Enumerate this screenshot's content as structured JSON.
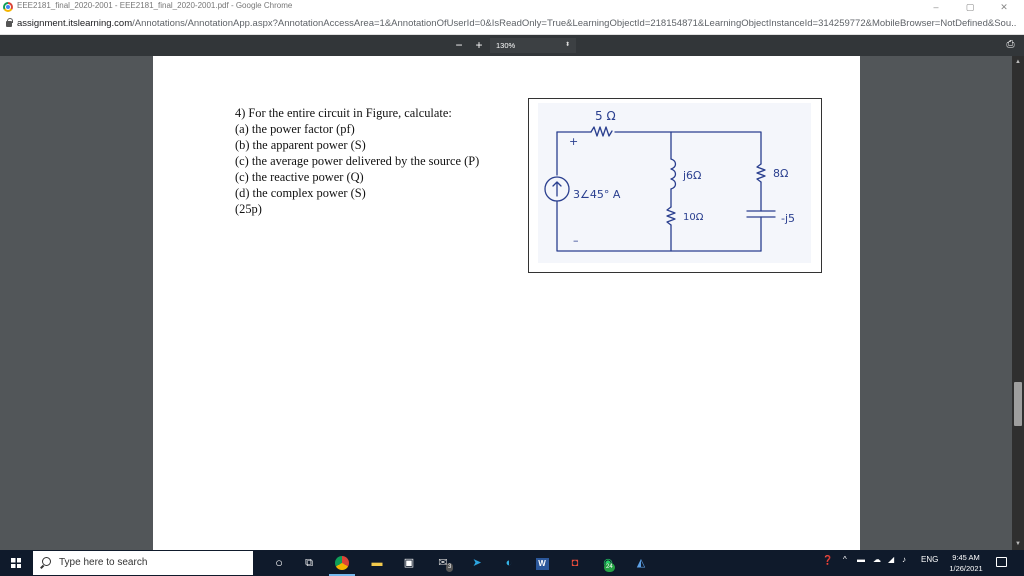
{
  "window": {
    "title": "EEE2181_final_2020-2001 - EEE2181_final_2020-2001.pdf - Google Chrome",
    "controls": {
      "minimize": "–",
      "restore": "▢",
      "close": "✕"
    }
  },
  "address": {
    "host": "assignment.itslearning.com",
    "path": "/Annotations/AnnotationApp.aspx?AnnotationAccessArea=1&AnnotationOfUserId=0&IsReadOnly=True&LearningObjectId=218154871&LearningObjectInstanceId=314259772&MobileBrowser=NotDefined&Sou..."
  },
  "pdf_toolbar": {
    "zoom_out": "−",
    "zoom_in": "+",
    "zoom_value": "130%",
    "zoom_caret": "⬍",
    "print": "⎙"
  },
  "question": {
    "lines": [
      "4) For the entire circuit in Figure, calculate:",
      "(a) the power factor (pf)",
      "(b) the apparent power (S)",
      "(c) the average power delivered by the source (P)",
      "(c) the reactive power (Q)",
      "(d) the complex power  (S)",
      "(25p)"
    ]
  },
  "figure": {
    "r1": "5 Ω",
    "plus": "+",
    "minus": "–",
    "source": "3∠45° A",
    "inductor": "j6Ω",
    "r_mid": "10Ω",
    "r_right": "8Ω",
    "capacitor": "-j5"
  },
  "taskbar": {
    "search_placeholder": "Type here to search",
    "icons": [
      "task-view-icon",
      "chrome-icon",
      "file-explorer-icon",
      "store-icon",
      "mail-icon",
      "telegram-icon",
      "edge-icon",
      "word-icon",
      "ticket-icon",
      "whatsapp-icon",
      "photos-icon"
    ],
    "badge_mail": "3",
    "badge_whatsapp": "24",
    "tray": {
      "chevron": "^",
      "lang": "ENG"
    },
    "time": "9:45 AM",
    "date": "1/26/2021"
  },
  "colors": {
    "pdf_toolbar": "#323639",
    "viewer_bg": "#525659",
    "taskbar": "#0f1a2b",
    "ink": "#2a3f8f"
  }
}
